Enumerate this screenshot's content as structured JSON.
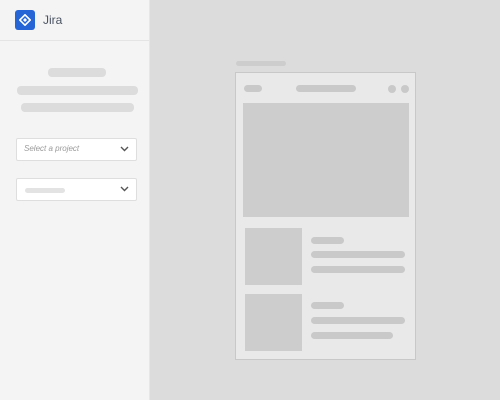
{
  "app": {
    "name": "Jira",
    "logo_icon": "jira-diamond-logo",
    "brand_color": "#2565d6"
  },
  "project_select": {
    "placeholder": "Select a project",
    "icon": "chevron-down-icon"
  },
  "second_select": {
    "icon": "chevron-down-icon"
  }
}
